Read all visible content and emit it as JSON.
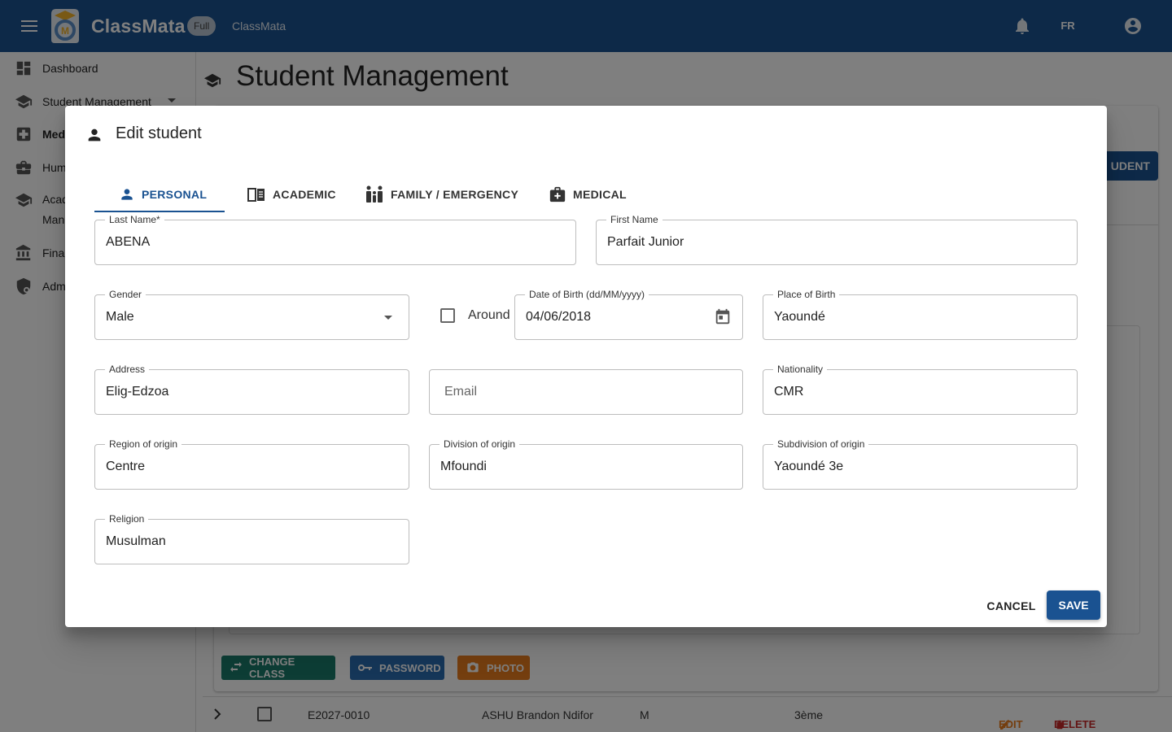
{
  "app": {
    "name": "ClassMata",
    "badge": "Full",
    "subtitle": "ClassMata",
    "language": "FR"
  },
  "sidebar": {
    "items": [
      {
        "label": "Dashboard",
        "icon": "dashboard-icon"
      },
      {
        "label": "Student Management",
        "icon": "school-icon"
      },
      {
        "label": "Med",
        "icon": "medical-icon"
      },
      {
        "label": "Hum",
        "icon": "briefcase-icon"
      },
      {
        "label": "Acad",
        "label2": "Man",
        "icon": "school-icon"
      },
      {
        "label": "Finar",
        "icon": "bank-icon"
      },
      {
        "label": "Adm",
        "icon": "admin-shield-icon"
      }
    ]
  },
  "page": {
    "title": "Student Management",
    "add_button_fragment": "UDENT",
    "bulk_actions": {
      "change_class": "CHANGE CLASS",
      "password": "PASSWORD",
      "photo": "PHOTO"
    },
    "row": {
      "id": "E2027-0010",
      "name": "ASHU Brandon Ndifor",
      "gender": "M",
      "class": "3ème",
      "edit": "EDIT",
      "delete": "DELETE"
    }
  },
  "dialog": {
    "title": "Edit student",
    "tabs": [
      {
        "label": "PERSONAL",
        "active": true
      },
      {
        "label": "ACADEMIC"
      },
      {
        "label": "FAMILY / EMERGENCY"
      },
      {
        "label": "MEDICAL"
      }
    ],
    "fields": {
      "last_name": {
        "label": "Last Name*",
        "value": "ABENA"
      },
      "first_name": {
        "label": "First Name",
        "value": "Parfait Junior"
      },
      "gender": {
        "label": "Gender",
        "value": "Male"
      },
      "around": {
        "label": "Around",
        "checked": false
      },
      "dob": {
        "label": "Date of Birth (dd/MM/yyyy)",
        "value": "04/06/2018"
      },
      "place_of_birth": {
        "label": "Place of Birth",
        "value": "Yaoundé"
      },
      "address": {
        "label": "Address",
        "value": "Elig-Edzoa"
      },
      "email": {
        "placeholder": "Email",
        "value": ""
      },
      "nationality": {
        "label": "Nationality",
        "value": "CMR"
      },
      "region": {
        "label": "Region of origin",
        "value": "Centre"
      },
      "division": {
        "label": "Division of origin",
        "value": "Mfoundi"
      },
      "subdivision": {
        "label": "Subdivision of origin",
        "value": "Yaoundé 3e"
      },
      "religion": {
        "label": "Religion",
        "value": "Musulman"
      }
    },
    "actions": {
      "cancel": "CANCEL",
      "save": "SAVE"
    }
  },
  "colors": {
    "primary": "#1a5291",
    "teal": "#1a7a6a",
    "blue": "#2b6cb0",
    "orange": "#e87d1e",
    "danger": "#c62828"
  }
}
